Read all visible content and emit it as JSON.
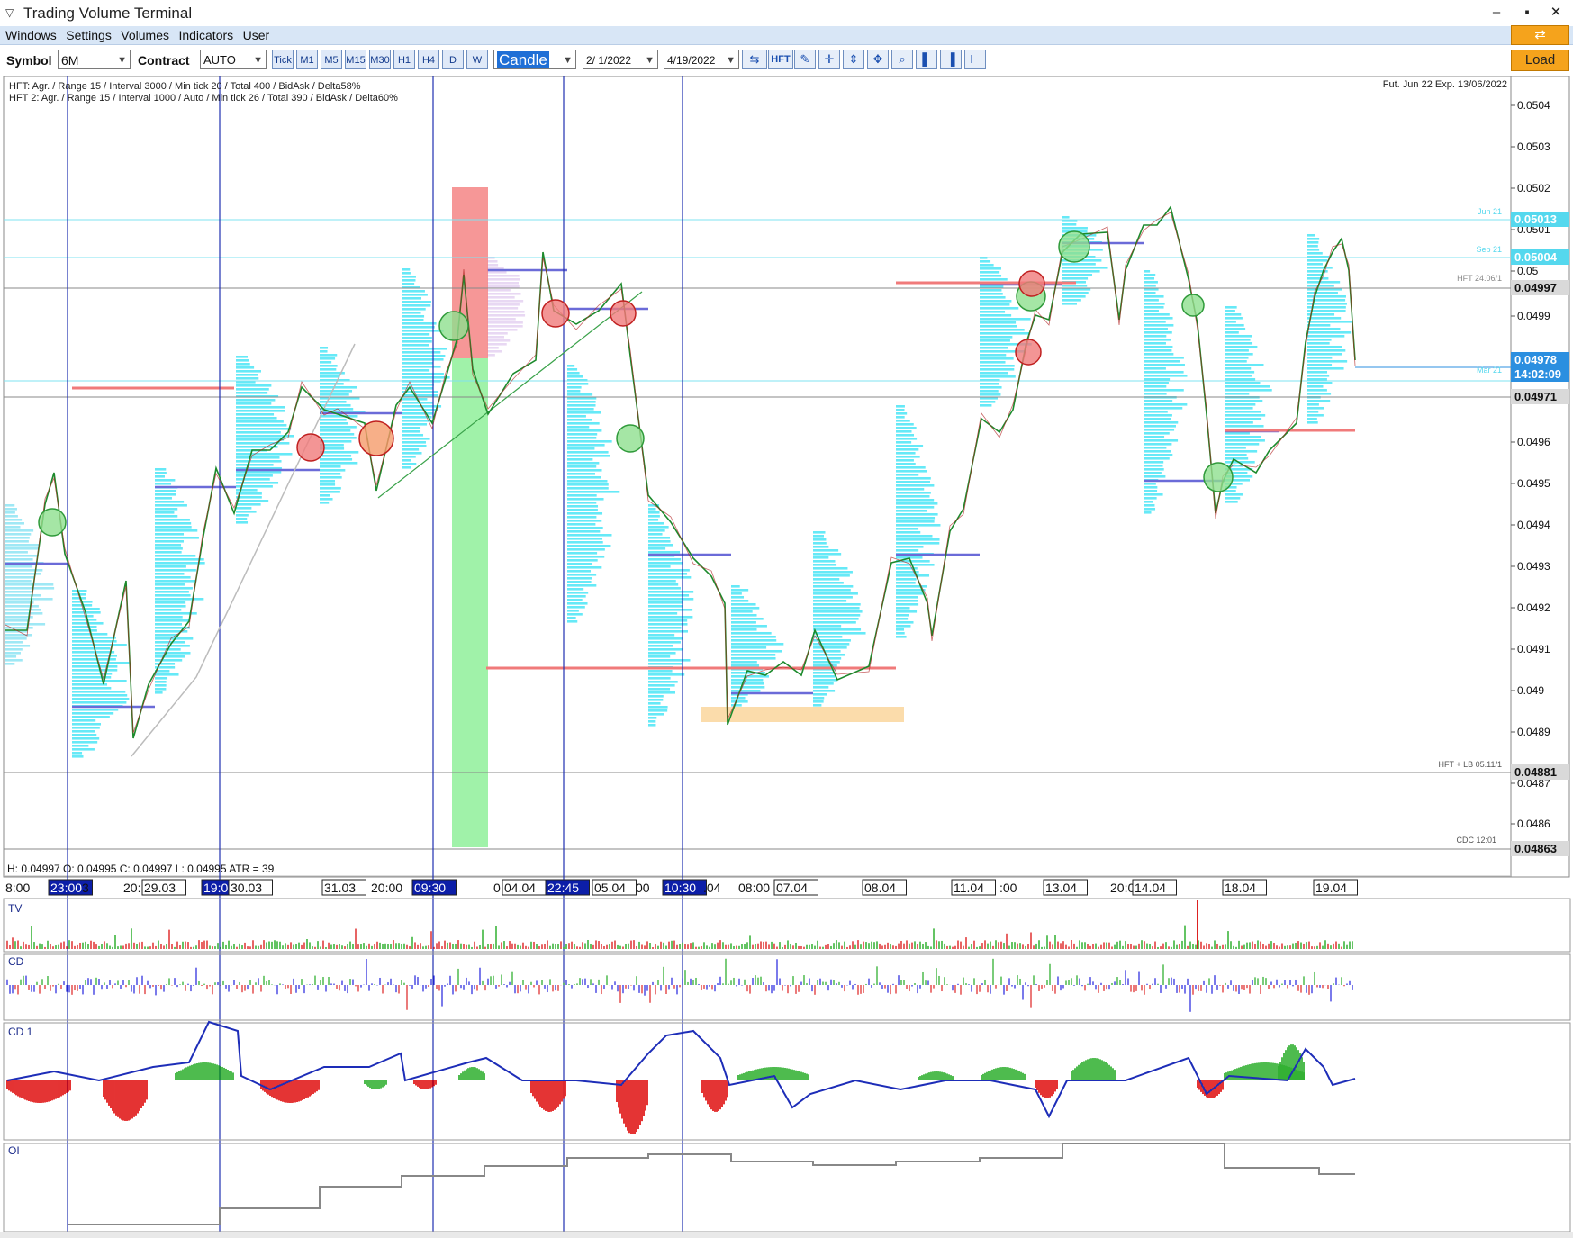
{
  "window": {
    "title": "Trading Volume Terminal"
  },
  "menu": {
    "items": [
      "Windows",
      "Settings",
      "Volumes",
      "Indicators",
      "User"
    ]
  },
  "toolbar": {
    "symbol_label": "Symbol",
    "symbol_value": "6M",
    "contract_label": "Contract",
    "contract_value": "AUTO",
    "timeframes": [
      "Tick",
      "M1",
      "M5",
      "M15",
      "M30",
      "H1",
      "H4",
      "D",
      "W"
    ],
    "chart_type": "Candle",
    "date_from": "2/ 1/2022",
    "date_to": "4/19/2022",
    "hft_label": "HFT",
    "load_label": "Load",
    "icons": [
      "link-icon",
      "hft-icon",
      "pen-icon",
      "crosshair-icon",
      "vertical-zoom-icon",
      "fit-icon",
      "magnifier-icon",
      "volume-settings-icon",
      "profile-settings-icon",
      "measure-icon"
    ]
  },
  "chart": {
    "info_line1": "HFT: Agr. / Range 15 / Interval 3000 / Min tick 20 / Total 400 / BidAsk / Delta58%",
    "info_line2": "HFT 2: Agr. / Range 15 / Interval 1000 / Auto / Min tick 26 / Total 390 / BidAsk / Delta60%",
    "contract_info": "Fut. Jun 22 Exp. 13/06/2022",
    "ohlc_line": "H: 0.04997  O: 0.04995  C: 0.04997  L: 0.04995  ATR = 39",
    "price_ticks": [
      "0.0504",
      "0.0503",
      "0.0502",
      "0.0501",
      "0.05",
      "0.0499",
      "0.0496",
      "0.0495",
      "0.0494",
      "0.0493",
      "0.0492",
      "0.0491",
      "0.049",
      "0.0489",
      "0.0487",
      "0.0486"
    ],
    "price_marks": [
      {
        "label": "0.05013",
        "style": "cyan"
      },
      {
        "label": "0.05004",
        "style": "cyan"
      },
      {
        "label": "0.04997",
        "style": "gray"
      },
      {
        "label": "0.04978",
        "style": "blue"
      },
      {
        "label": "14:02:09",
        "style": "blue"
      },
      {
        "label": "0.04971",
        "style": "gray"
      },
      {
        "label": "0.04881",
        "style": "gray"
      },
      {
        "label": "0.04863",
        "style": "gray"
      }
    ],
    "level_labels": [
      "Jun 21",
      "Sep 21",
      "HFT 24.06/1",
      "Mar 21",
      "HFT + LB 05.11/1",
      "CDC 12:01"
    ],
    "time_labels": [
      {
        "text": "8:00",
        "boxed": false,
        "highlight": false
      },
      {
        "text": "23:00",
        "boxed": true,
        "highlight": true
      },
      {
        "text": "3",
        "boxed": false,
        "highlight": false
      },
      {
        "text": "20:",
        "boxed": false,
        "highlight": false
      },
      {
        "text": "29.03",
        "boxed": true,
        "highlight": false
      },
      {
        "text": "19:00",
        "boxed": true,
        "highlight": true
      },
      {
        "text": "30.03",
        "boxed": true,
        "highlight": false
      },
      {
        "text": "31.03",
        "boxed": true,
        "highlight": false
      },
      {
        "text": "20:00",
        "boxed": false,
        "highlight": false
      },
      {
        "text": "09:30",
        "boxed": true,
        "highlight": true
      },
      {
        "text": "0",
        "boxed": false,
        "highlight": false
      },
      {
        "text": "04.04",
        "boxed": true,
        "highlight": false
      },
      {
        "text": "22:45",
        "boxed": true,
        "highlight": true
      },
      {
        "text": "05.04",
        "boxed": true,
        "highlight": false
      },
      {
        "text": "00",
        "boxed": false,
        "highlight": false
      },
      {
        "text": "10:30",
        "boxed": true,
        "highlight": true
      },
      {
        "text": ".04",
        "boxed": false,
        "highlight": false
      },
      {
        "text": "08:00",
        "boxed": false,
        "highlight": false
      },
      {
        "text": "07.04",
        "boxed": true,
        "highlight": false
      },
      {
        "text": "08.04",
        "boxed": true,
        "highlight": false
      },
      {
        "text": "11.04",
        "boxed": true,
        "highlight": false
      },
      {
        "text": ":00",
        "boxed": false,
        "highlight": false
      },
      {
        "text": "13.04",
        "boxed": true,
        "highlight": false
      },
      {
        "text": "20:0",
        "boxed": false,
        "highlight": false
      },
      {
        "text": "14.04",
        "boxed": true,
        "highlight": false
      },
      {
        "text": "18.04",
        "boxed": true,
        "highlight": false
      },
      {
        "text": "19.04",
        "boxed": true,
        "highlight": false
      }
    ]
  },
  "panels": {
    "tv": "TV",
    "cd": "CD",
    "cd1": "CD 1",
    "oi": "OI"
  },
  "colors": {
    "menu_bg": "#d8e6f6",
    "accent": "#f5a31c",
    "profile": "#66e9f7",
    "poc": "#f07a7a",
    "vline": "#1f2fb0"
  }
}
